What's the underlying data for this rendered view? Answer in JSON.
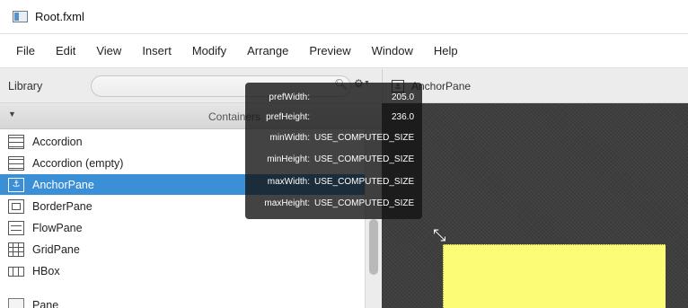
{
  "window": {
    "title": "Root.fxml"
  },
  "menubar": {
    "items": [
      "File",
      "Edit",
      "View",
      "Insert",
      "Modify",
      "Arrange",
      "Preview",
      "Window",
      "Help"
    ]
  },
  "library": {
    "label": "Library",
    "search": {
      "value": "",
      "placeholder": ""
    },
    "category": "Containers",
    "items": [
      {
        "label": "Accordion",
        "icon": "accordion-icon",
        "selected": false
      },
      {
        "label": "Accordion  (empty)",
        "icon": "accordion-icon",
        "selected": false
      },
      {
        "label": "AnchorPane",
        "icon": "anchor-pane-icon",
        "selected": true
      },
      {
        "label": "BorderPane",
        "icon": "border-pane-icon",
        "selected": false
      },
      {
        "label": "FlowPane",
        "icon": "flow-pane-icon",
        "selected": false
      },
      {
        "label": "GridPane",
        "icon": "grid-pane-icon",
        "selected": false
      },
      {
        "label": "HBox",
        "icon": "hbox-icon",
        "selected": false
      },
      {
        "label": "Pane",
        "icon": "pane-icon",
        "selected": false
      }
    ]
  },
  "canvas": {
    "title": "AnchorPane"
  },
  "tooltip": {
    "rows": [
      {
        "label": "prefWidth:",
        "value": "205.0"
      },
      {
        "label": "prefHeight:",
        "value": "236.0"
      },
      {
        "label": "minWidth:",
        "value": "USE_COMPUTED_SIZE"
      },
      {
        "label": "minHeight:",
        "value": "USE_COMPUTED_SIZE"
      },
      {
        "label": "maxWidth:",
        "value": "USE_COMPUTED_SIZE"
      },
      {
        "label": "maxHeight:",
        "value": "USE_COMPUTED_SIZE"
      }
    ]
  },
  "colors": {
    "selection": "#3b8fd6",
    "anchorpane_fill": "#fcfc77",
    "canvas_bg": "#3a3a3a"
  }
}
